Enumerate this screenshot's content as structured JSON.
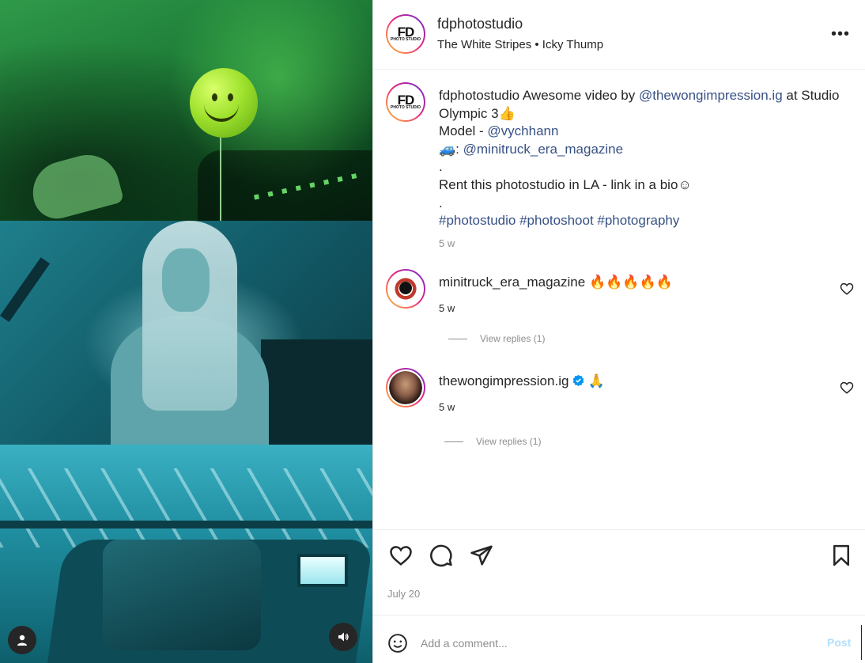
{
  "post": {
    "username": "fdphotostudio",
    "audio": "The White Stripes • Icky Thump",
    "avatar_logo": {
      "big": "FD",
      "small": "PHOTO STUDIO"
    },
    "more_label": "•••"
  },
  "caption": {
    "username": "fdphotostudio",
    "text_1": " Awesome video by ",
    "mention_1": "@thewongimpression.ig",
    "text_2": " at Studio Olympic 3👍",
    "model_label": "Model - ",
    "mention_2": "@vychhann",
    "car_emoji": "🚙",
    "car_sep": ": ",
    "mention_3": "@minitruck_era_magazine",
    "dot_1": ".",
    "rent_line": "Rent this photostudio in LA - link in a bio☺",
    "dot_2": ".",
    "hashtags": "#photostudio #photoshoot #photography",
    "time": "5 w"
  },
  "comments": [
    {
      "username": "minitruck_era_magazine",
      "text": "🔥🔥🔥🔥🔥",
      "time": "5 w",
      "replies": "View replies (1)"
    },
    {
      "username": "thewongimpression.ig",
      "verified": true,
      "text": "🙏",
      "time": "5 w",
      "replies": "View replies (1)"
    }
  ],
  "actions": {
    "date": "July 20"
  },
  "add_comment": {
    "placeholder": "Add a comment...",
    "post_label": "Post"
  },
  "colors": {
    "link": "#385185",
    "muted": "#8e8e8e",
    "post_disabled": "#b2dffc",
    "verified": "#0095f6"
  },
  "icons": [
    "heart-icon",
    "comment-icon",
    "share-icon",
    "bookmark-icon",
    "emoji-icon",
    "user-tag-icon",
    "volume-icon",
    "more-icon"
  ]
}
